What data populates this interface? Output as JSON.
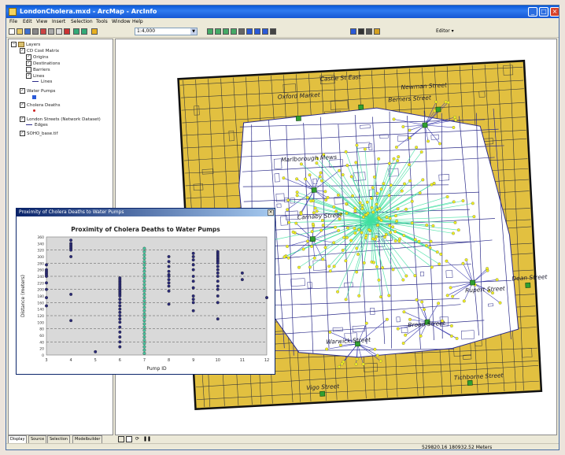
{
  "window": {
    "title": "LondonCholera.mxd - ArcMap - ArcInfo",
    "controls": {
      "minimize": "_",
      "maximize": "□",
      "close": "×"
    }
  },
  "menu": [
    "File",
    "Edit",
    "View",
    "Insert",
    "Selection",
    "Tools",
    "Window",
    "Help"
  ],
  "toolbar": {
    "scale_value": "1:4,000",
    "editor_label": "Editor ▾",
    "icons": [
      "new-icon",
      "open-icon",
      "save-icon",
      "print-icon",
      "cut-icon",
      "copy-icon",
      "paste-icon",
      "delete-icon",
      "undo-icon",
      "redo-icon",
      "add-data-icon",
      "zoom-in-icon",
      "zoom-out-icon",
      "fixed-zoom-in-icon",
      "fixed-zoom-out-icon",
      "pan-icon",
      "full-extent-icon",
      "back-icon",
      "forward-icon",
      "select-icon",
      "identify-icon",
      "find-icon",
      "measure-icon",
      "hyperlink-icon"
    ]
  },
  "toc": {
    "root": "Layers",
    "items": [
      {
        "label": "CD Cost Matrix",
        "level": 1,
        "checked": true
      },
      {
        "label": "Origins",
        "level": 2,
        "checked": true
      },
      {
        "label": "Destinations",
        "level": 2,
        "checked": true
      },
      {
        "label": "Barriers",
        "level": 2,
        "checked": false
      },
      {
        "label": "Lines",
        "level": 2,
        "checked": true
      },
      {
        "label": "Lines",
        "level": 3,
        "checked": null
      },
      {
        "label": "Water Pumps",
        "level": 1,
        "checked": true
      },
      {
        "label": "Cholera Deaths",
        "level": 1,
        "checked": true
      },
      {
        "label": "London Streets (Network Dataset)",
        "level": 1,
        "checked": true
      },
      {
        "label": "Edges",
        "level": 2,
        "checked": null
      },
      {
        "label": "SOHO_base.tif",
        "level": 1,
        "checked": true
      }
    ],
    "tabs": [
      "Display",
      "Source",
      "Selection",
      "Modelbuilder"
    ]
  },
  "map": {
    "street_labels": [
      "Castle St East",
      "Oxford Market",
      "Newman Street",
      "Berners Street",
      "Marlborough Mews",
      "Carnaby Street",
      "Dean Street",
      "Rupert Street",
      "Broad Street",
      "Warwick Street",
      "Vigo Street",
      "Tichborne Street"
    ],
    "colors": {
      "background": "#e2c040",
      "streets": "#2c2c8a",
      "deaths": "#f0f020",
      "lines": "#40e0a0",
      "pumps": "#30a030"
    }
  },
  "graph_window": {
    "title": "Proximity of Cholera Deaths to Water Pumps",
    "close_label": "×"
  },
  "chart_data": {
    "type": "scatter",
    "title": "Proximity of Cholera Deaths to Water Pumps",
    "xlabel": "Pump ID",
    "ylabel": "Distance (meters)",
    "xlim": [
      3,
      12
    ],
    "ylim": [
      0,
      360
    ],
    "x_ticks": [
      3,
      4,
      5,
      6,
      7,
      8,
      9,
      10,
      11,
      12
    ],
    "y_ticks": [
      0,
      20,
      40,
      60,
      80,
      100,
      120,
      140,
      160,
      180,
      200,
      220,
      240,
      260,
      280,
      300,
      320,
      340,
      360
    ],
    "grid": true,
    "series": [
      {
        "color": "#2b2b7a",
        "points": [
          [
            3,
            275
          ],
          [
            3,
            260
          ],
          [
            3,
            255
          ],
          [
            3,
            250
          ],
          [
            3,
            245
          ],
          [
            3,
            240
          ],
          [
            3,
            220
          ],
          [
            3,
            200
          ],
          [
            3,
            175
          ],
          [
            3,
            150
          ],
          [
            4,
            350
          ],
          [
            4,
            340
          ],
          [
            4,
            335
          ],
          [
            4,
            330
          ],
          [
            4,
            325
          ],
          [
            4,
            320
          ],
          [
            4,
            300
          ],
          [
            4,
            185
          ],
          [
            4,
            105
          ],
          [
            5,
            10
          ],
          [
            6,
            235
          ],
          [
            6,
            230
          ],
          [
            6,
            225
          ],
          [
            6,
            220
          ],
          [
            6,
            215
          ],
          [
            6,
            210
          ],
          [
            6,
            205
          ],
          [
            6,
            200
          ],
          [
            6,
            195
          ],
          [
            6,
            190
          ],
          [
            6,
            185
          ],
          [
            6,
            180
          ],
          [
            6,
            170
          ],
          [
            6,
            160
          ],
          [
            6,
            150
          ],
          [
            6,
            140
          ],
          [
            6,
            130
          ],
          [
            6,
            120
          ],
          [
            6,
            110
          ],
          [
            6,
            100
          ],
          [
            6,
            85
          ],
          [
            6,
            70
          ],
          [
            6,
            55
          ],
          [
            6,
            40
          ],
          [
            6,
            25
          ],
          [
            8,
            300
          ],
          [
            8,
            285
          ],
          [
            8,
            270
          ],
          [
            8,
            255
          ],
          [
            8,
            245
          ],
          [
            8,
            240
          ],
          [
            8,
            230
          ],
          [
            8,
            220
          ],
          [
            8,
            210
          ],
          [
            8,
            195
          ],
          [
            8,
            155
          ],
          [
            9,
            310
          ],
          [
            9,
            300
          ],
          [
            9,
            290
          ],
          [
            9,
            275
          ],
          [
            9,
            260
          ],
          [
            9,
            240
          ],
          [
            9,
            225
          ],
          [
            9,
            205
          ],
          [
            9,
            180
          ],
          [
            9,
            170
          ],
          [
            9,
            160
          ],
          [
            9,
            135
          ],
          [
            10,
            315
          ],
          [
            10,
            310
          ],
          [
            10,
            305
          ],
          [
            10,
            300
          ],
          [
            10,
            295
          ],
          [
            10,
            290
          ],
          [
            10,
            285
          ],
          [
            10,
            280
          ],
          [
            10,
            270
          ],
          [
            10,
            260
          ],
          [
            10,
            250
          ],
          [
            10,
            240
          ],
          [
            10,
            225
          ],
          [
            10,
            210
          ],
          [
            10,
            200
          ],
          [
            10,
            180
          ],
          [
            10,
            160
          ],
          [
            10,
            110
          ],
          [
            11,
            250
          ],
          [
            11,
            230
          ],
          [
            12,
            175
          ]
        ]
      },
      {
        "color": "#48c8a0",
        "points": [
          [
            7,
            5
          ],
          [
            7,
            15
          ],
          [
            7,
            25
          ],
          [
            7,
            35
          ],
          [
            7,
            45
          ],
          [
            7,
            55
          ],
          [
            7,
            65
          ],
          [
            7,
            75
          ],
          [
            7,
            85
          ],
          [
            7,
            95
          ],
          [
            7,
            105
          ],
          [
            7,
            115
          ],
          [
            7,
            125
          ],
          [
            7,
            135
          ],
          [
            7,
            145
          ],
          [
            7,
            155
          ],
          [
            7,
            165
          ],
          [
            7,
            175
          ],
          [
            7,
            185
          ],
          [
            7,
            195
          ],
          [
            7,
            205
          ],
          [
            7,
            215
          ],
          [
            7,
            225
          ],
          [
            7,
            235
          ],
          [
            7,
            245
          ],
          [
            7,
            255
          ],
          [
            7,
            265
          ],
          [
            7,
            275
          ],
          [
            7,
            285
          ],
          [
            7,
            295
          ],
          [
            7,
            305
          ],
          [
            7,
            315
          ],
          [
            7,
            325
          ]
        ]
      }
    ]
  },
  "status": {
    "coordinates": "529820.16  180932.52 Meters"
  },
  "map_tabs": [
    "layout-view",
    "data-view",
    "refresh",
    "pause"
  ]
}
